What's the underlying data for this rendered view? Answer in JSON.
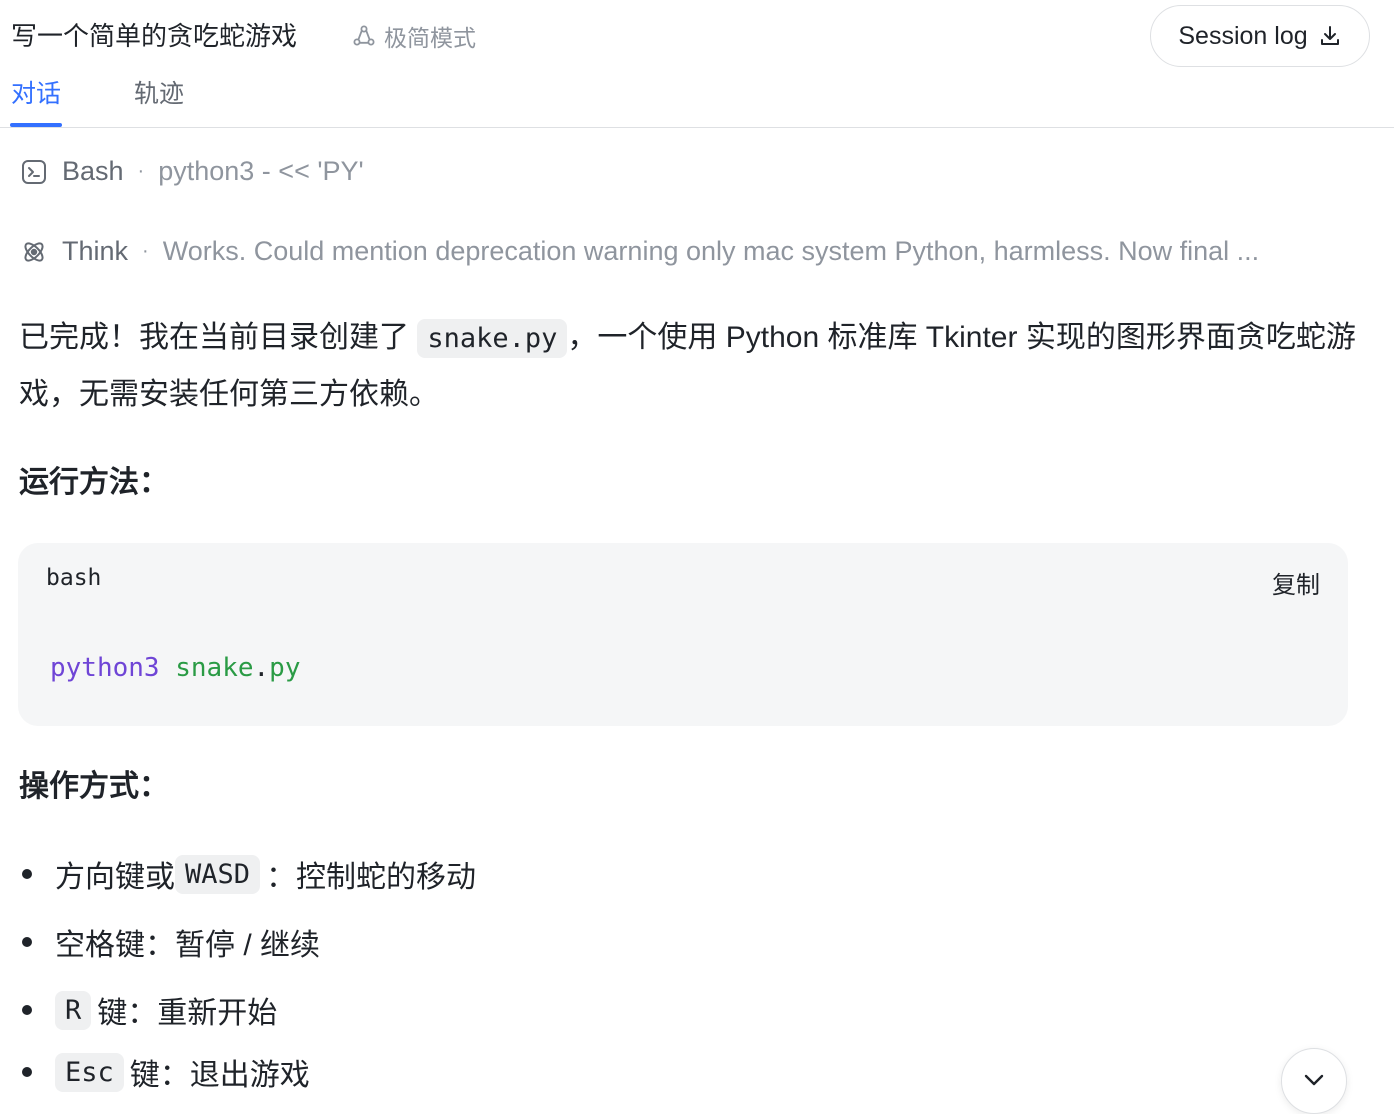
{
  "header": {
    "title": "写一个简单的贪吃蛇游戏",
    "mode_label": "极简模式",
    "session_button": "Session log",
    "tabs": [
      {
        "label": "对话",
        "active": true
      },
      {
        "label": "轨迹",
        "active": false
      }
    ],
    "accent_color": "#3370ff"
  },
  "tool_calls": [
    {
      "icon": "terminal-icon",
      "label": "Bash",
      "detail": "python3 - << 'PY'"
    },
    {
      "icon": "brain-icon",
      "label": "Think",
      "detail": "Works. Could mention deprecation warning only mac system Python, harmless. Now final ..."
    }
  ],
  "message": {
    "intro_before": "已完成！我在当前目录创建了 ",
    "intro_code": "snake.py",
    "intro_after": "，一个使用 Python 标准库 Tkinter 实现的图形界面贪吃蛇游戏，无需安装任何第三方依赖。",
    "run_heading": "运行方法：",
    "code_block": {
      "language": "bash",
      "copy_label": "复制",
      "command": "python3",
      "arg_name": "snake",
      "arg_dot": ".",
      "arg_ext": "py"
    },
    "ops_heading": "操作方式：",
    "list": [
      {
        "prefix": "方向键或 ",
        "key": "WASD",
        "text": "：控制蛇的移动"
      },
      {
        "prefix": "",
        "key": "",
        "text": "空格键：暂停 / 继续"
      },
      {
        "prefix": "",
        "key": "R",
        "text": "键：重新开始"
      },
      {
        "prefix": "",
        "key": "Esc",
        "text": "键：退出游戏"
      }
    ]
  },
  "controls": {
    "scroll_down_icon": "chevron-down-icon"
  }
}
